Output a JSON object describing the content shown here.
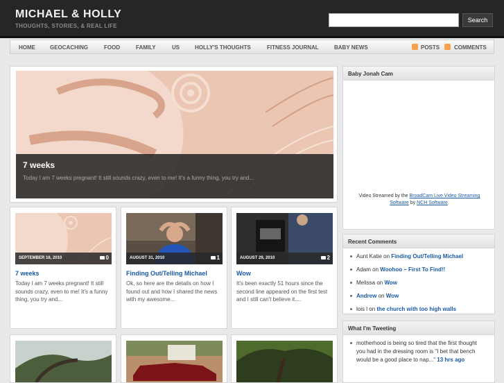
{
  "site": {
    "title": "MICHAEL & HOLLY",
    "description": "THOUGHTS, STORIES, & REAL LIFE"
  },
  "search": {
    "placeholder": "",
    "button_label": "Search"
  },
  "nav": {
    "items": [
      "HOME",
      "GEOCACHING",
      "FOOD",
      "FAMILY",
      "US",
      "HOLLY'S THOUGHTS",
      "FITNESS JOURNAL",
      "BABY NEWS"
    ],
    "posts_label": "POSTS",
    "comments_label": "COMMENTS"
  },
  "featured": {
    "title": "7 weeks",
    "excerpt": "Today I am 7 weeks pregnant! It still sounds crazy, even to me! It's a funny thing, you try and..."
  },
  "posts": [
    {
      "date": "SEPTEMBER 16, 2010",
      "comments": "0",
      "title": "7 weeks",
      "excerpt": "Today I am 7 weeks pregnant! It still sounds crazy, even to me! It's a funny thing, you try and..."
    },
    {
      "date": "AUGUST 31, 2010",
      "comments": "1",
      "title": "Finding Out/Telling Michael",
      "excerpt": "Ok, so here are the details on how I found out and how I shared the news with my awesome..."
    },
    {
      "date": "AUGUST 29, 2010",
      "comments": "2",
      "title": "Wow",
      "excerpt": "It's been exactly 51 hours since the second line appeared on the first test and I still can't believe it...."
    }
  ],
  "cam_widget": {
    "title": "Baby Jonah Cam",
    "text_before": "Video Streamed by the ",
    "link1": "BroadCam Live Video Streaming Software",
    "text_mid": " by ",
    "link2": "NCH Software",
    "text_after": "."
  },
  "recent_comments": {
    "title": "Recent Comments",
    "items": [
      {
        "author": "Aunt Katie",
        "on": "on",
        "post": "Finding Out/Telling Michael"
      },
      {
        "author": "Adam",
        "on": "on",
        "post": "Woohoo – First To Find!!"
      },
      {
        "author": "Melissa",
        "on": "on",
        "post": "Wow"
      },
      {
        "author": "Andrew",
        "on": "on",
        "post": "Wow"
      },
      {
        "author": "lois l",
        "on": "on",
        "post": "the church with too high walls"
      }
    ]
  },
  "tweeting": {
    "title": "What I'm Tweeting",
    "text": "motherhood is being so tired that the first thought you had in the dressing room is \"I bet that bench would be a good place to nap...\"",
    "time": "13 hrs ago"
  }
}
